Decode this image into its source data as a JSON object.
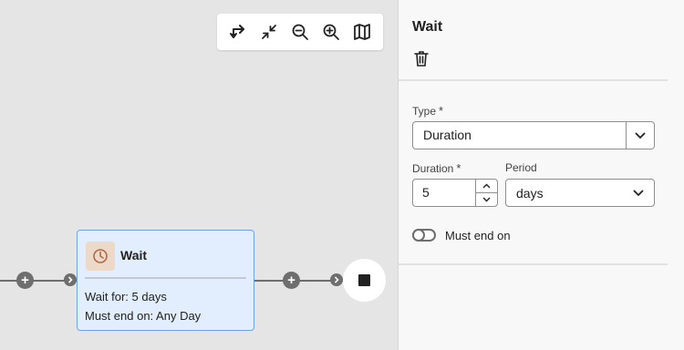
{
  "toolbar": {
    "icons": [
      "rearrange-icon",
      "collapse-icon",
      "zoom-out-icon",
      "zoom-in-icon",
      "map-icon"
    ]
  },
  "node": {
    "title": "Wait",
    "icon": "clock-icon",
    "line1": "Wait for: 5 days",
    "line2": "Must end on: Any Day",
    "colors": {
      "background": "#e2edfd",
      "border": "#6fa3e8",
      "icon_bg": "#ecd9c8",
      "icon_fg": "#b0694a"
    }
  },
  "panel": {
    "title": "Wait",
    "type_label": "Type",
    "type_required": "*",
    "type_value": "Duration",
    "duration_label": "Duration",
    "duration_required": "*",
    "duration_value": "5",
    "period_label": "Period",
    "period_value": "days",
    "must_end_label": "Must end on",
    "must_end_on": false
  }
}
